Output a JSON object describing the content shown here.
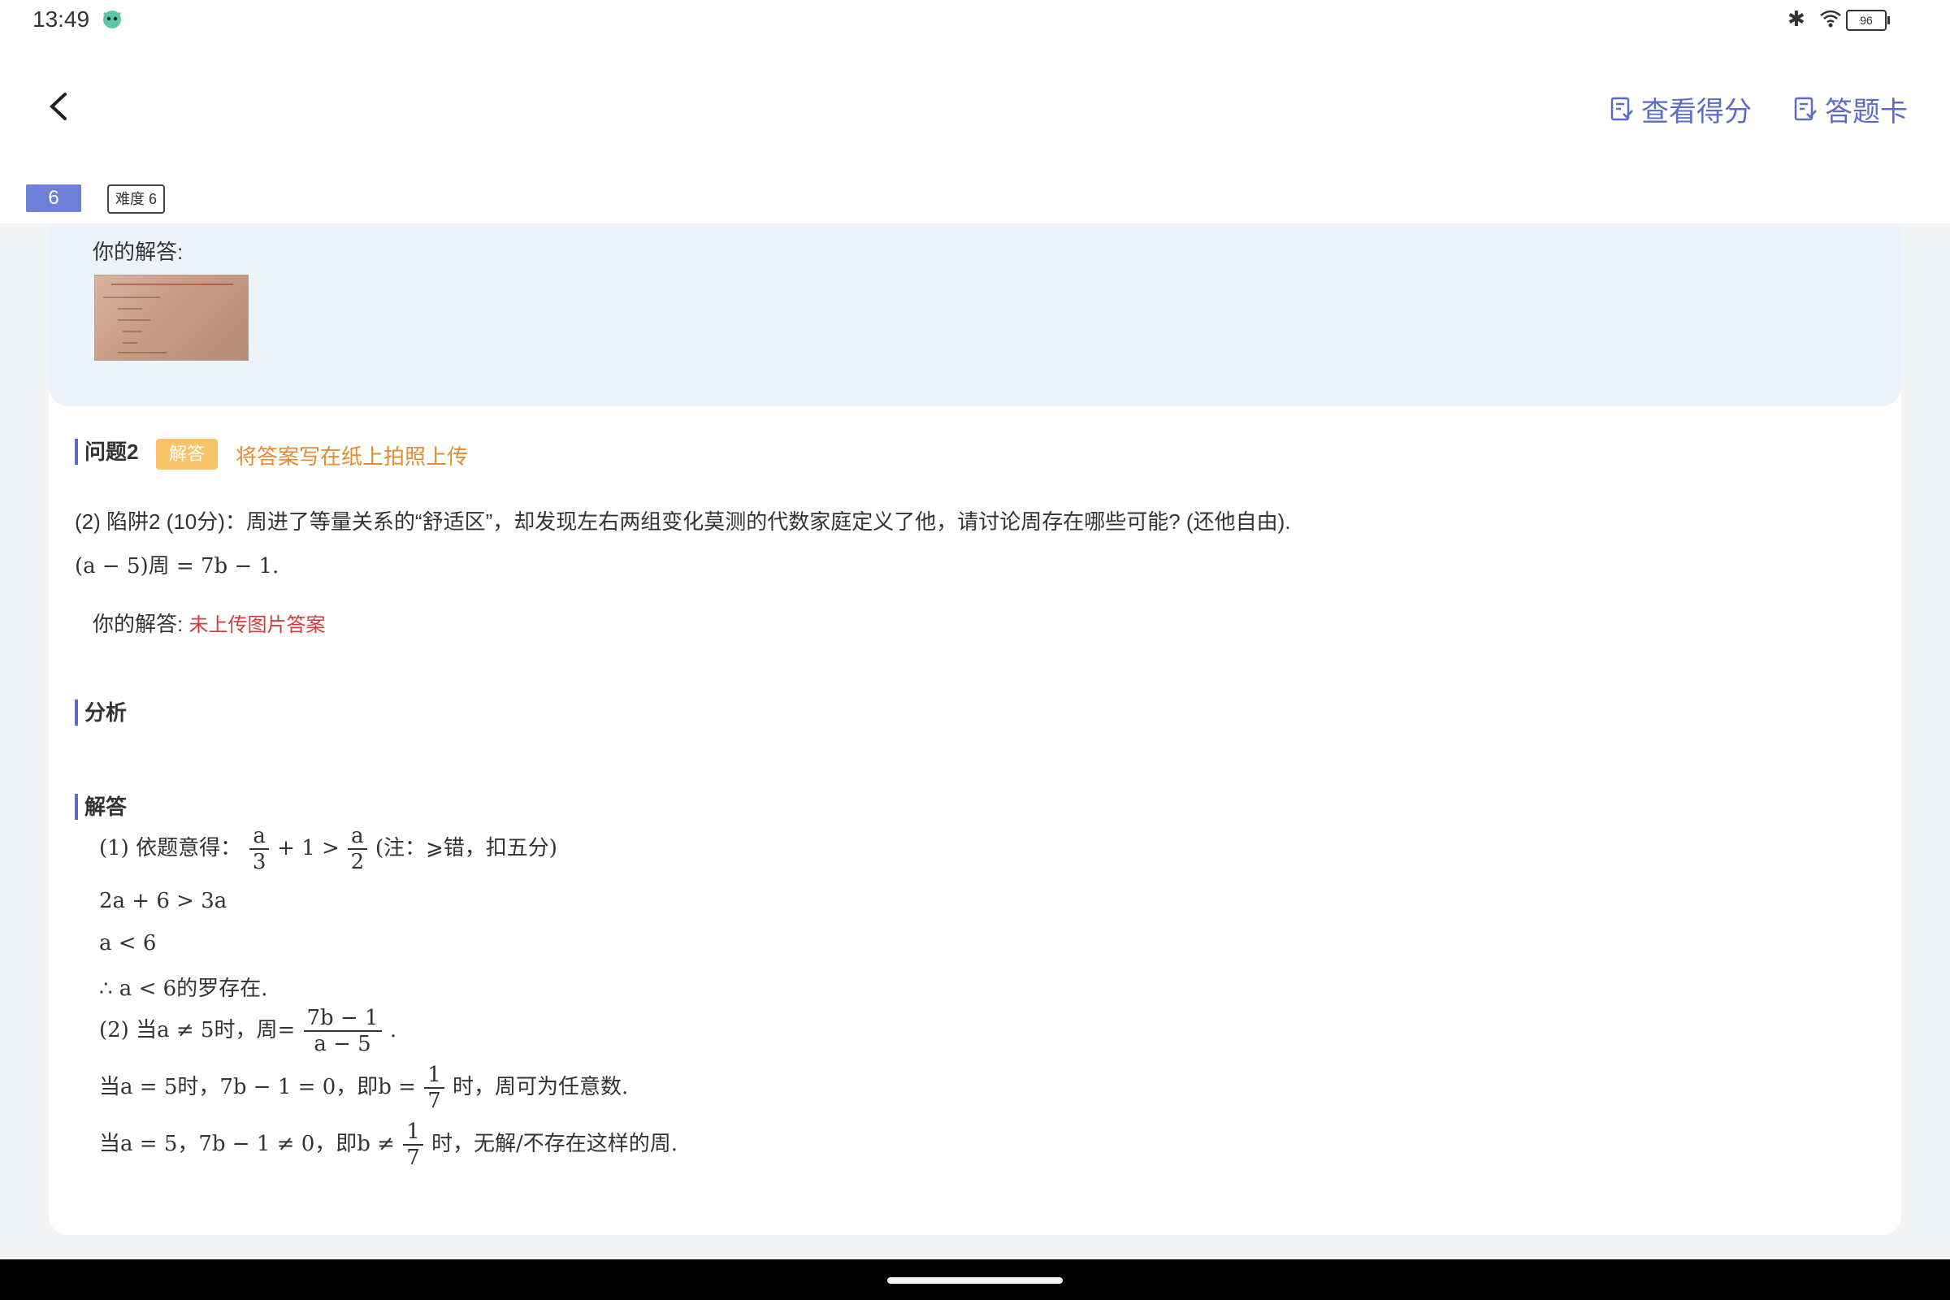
{
  "status": {
    "time": "13:49",
    "battery": "96"
  },
  "header": {
    "score_label": "查看得分",
    "card_label": "答题卡"
  },
  "question": {
    "number": "6",
    "difficulty": "难度 6"
  },
  "first_answer": {
    "label": "你的解答:"
  },
  "q2": {
    "title": "问题2",
    "tag": "解答",
    "note": "将答案写在纸上拍照上传",
    "text": "(2) 陷阱2 (10分)：周进了等量关系的“舒适区”，却发现左右两组变化莫测的代数家庭定义了他，请讨论周存在哪些可能? (还他自由).",
    "math": "(a − 5)周 = 7b − 1.",
    "answer_label": "你的解答:",
    "answer_status": "未上传图片答案"
  },
  "analysis": {
    "title": "分析"
  },
  "solution": {
    "title": "解答",
    "l1_prefix": "(1) 依题意得：",
    "l1_num1": "a",
    "l1_den1": "3",
    "l1_mid": "+ 1 >",
    "l1_num2": "a",
    "l1_den2": "2",
    "l1_suffix": "(注：⩾错，扣五分)",
    "l2": "2a + 6 > 3a",
    "l3": "a < 6",
    "l4": "∴ a < 6的罗存在.",
    "l5_prefix": "(2) 当a ≠ 5时，周=",
    "l5_num": "7b − 1",
    "l5_den": "a − 5",
    "l5_suffix": ".",
    "l6_prefix": "当a = 5时，7b − 1 = 0，即b =",
    "l6_num": "1",
    "l6_den": "7",
    "l6_suffix": "时，周可为任意数.",
    "l7_prefix": "当a = 5，7b − 1 ≠ 0，即b ≠",
    "l7_num": "1",
    "l7_den": "7",
    "l7_suffix": "时，无解/不存在这样的周."
  },
  "colors": {
    "accent": "#5b6cc8",
    "tag": "#f8c46a",
    "note": "#e98a2d",
    "error": "#d33c3c"
  }
}
